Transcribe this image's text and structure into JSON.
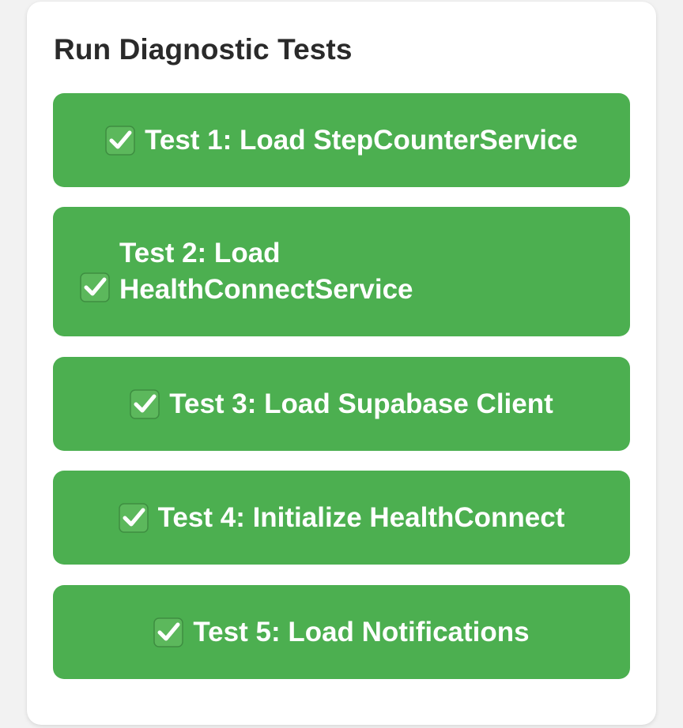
{
  "panel": {
    "title": "Run Diagnostic Tests"
  },
  "tests": [
    {
      "label": "Test 1: Load StepCounterService",
      "status_icon": "check-mark-button-icon"
    },
    {
      "label": "Test 2: Load HealthConnectService",
      "status_icon": "check-mark-button-icon"
    },
    {
      "label": "Test 3: Load Supabase Client",
      "status_icon": "check-mark-button-icon"
    },
    {
      "label": "Test 4: Initialize HealthConnect",
      "status_icon": "check-mark-button-icon"
    },
    {
      "label": "Test 5: Load Notifications",
      "status_icon": "check-mark-button-icon"
    }
  ],
  "colors": {
    "button": "#4caf50",
    "check_box": "#5cb85c",
    "title_text": "#2a2a2a"
  }
}
